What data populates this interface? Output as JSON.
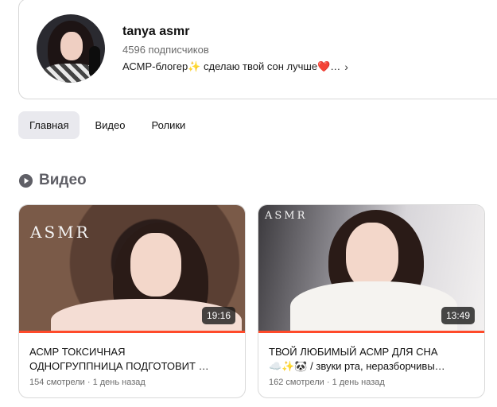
{
  "channel": {
    "name": "tanya asmr",
    "subscribers": "4596 подписчиков",
    "description": "АСМР-блогер✨ сделаю твой сон лучше❤️…"
  },
  "tabs": [
    {
      "label": "Главная",
      "active": true
    },
    {
      "label": "Видео",
      "active": false
    },
    {
      "label": "Ролики",
      "active": false
    }
  ],
  "section": {
    "title": "Видео",
    "icon": "play-circle-icon"
  },
  "videos": [
    {
      "thumb_text": "ASMR",
      "duration": "19:16",
      "title_line1": "АСМР ТОКСИЧНАЯ",
      "title_line2": "ОДНОГРУППНИЦА ПОДГОТОВИТ …",
      "meta": "154 смотрели · 1 день назад"
    },
    {
      "thumb_text": "ASMR",
      "duration": "13:49",
      "title_line1": "ТВОЙ ЛЮБИМЫЙ АСМР ДЛЯ СНА",
      "title_line2": "☁️✨🐼 / звуки рта, неразборчивы…",
      "meta": "162 смотрели · 1 день назад"
    }
  ],
  "colors": {
    "accent": "#ff4a2a",
    "tab_active_bg": "#e9e9ee",
    "section_title": "#5f5f66"
  }
}
